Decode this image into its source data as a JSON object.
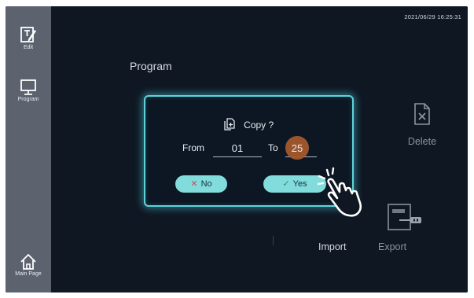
{
  "header": {
    "datetime": "2021/06/29 16:25:31"
  },
  "sidebar": {
    "items": [
      {
        "label": "Edit",
        "icon": "edit-icon"
      },
      {
        "label": "Program",
        "icon": "monitor-icon"
      },
      {
        "label": "Main Page",
        "icon": "home-icon"
      }
    ]
  },
  "main": {
    "section_title": "Program",
    "tiles": {
      "delete": {
        "label": "Delete",
        "icon": "delete-file-icon"
      },
      "import": {
        "label": "Import"
      },
      "export": {
        "label": "Export",
        "icon": "usb-export-icon"
      }
    }
  },
  "dialog": {
    "title": "Copy ?",
    "from_label": "From",
    "from_value": "01",
    "to_label": "To",
    "to_value": "25",
    "no_label": "No",
    "yes_label": "Yes",
    "no_icon": "x-icon",
    "yes_icon": "check-icon"
  },
  "colors": {
    "sidebar": "#5c636f",
    "background": "#0f1723",
    "dialog_border": "#5fd3d9",
    "button": "#82dcdc",
    "highlight": "#a4582c"
  }
}
